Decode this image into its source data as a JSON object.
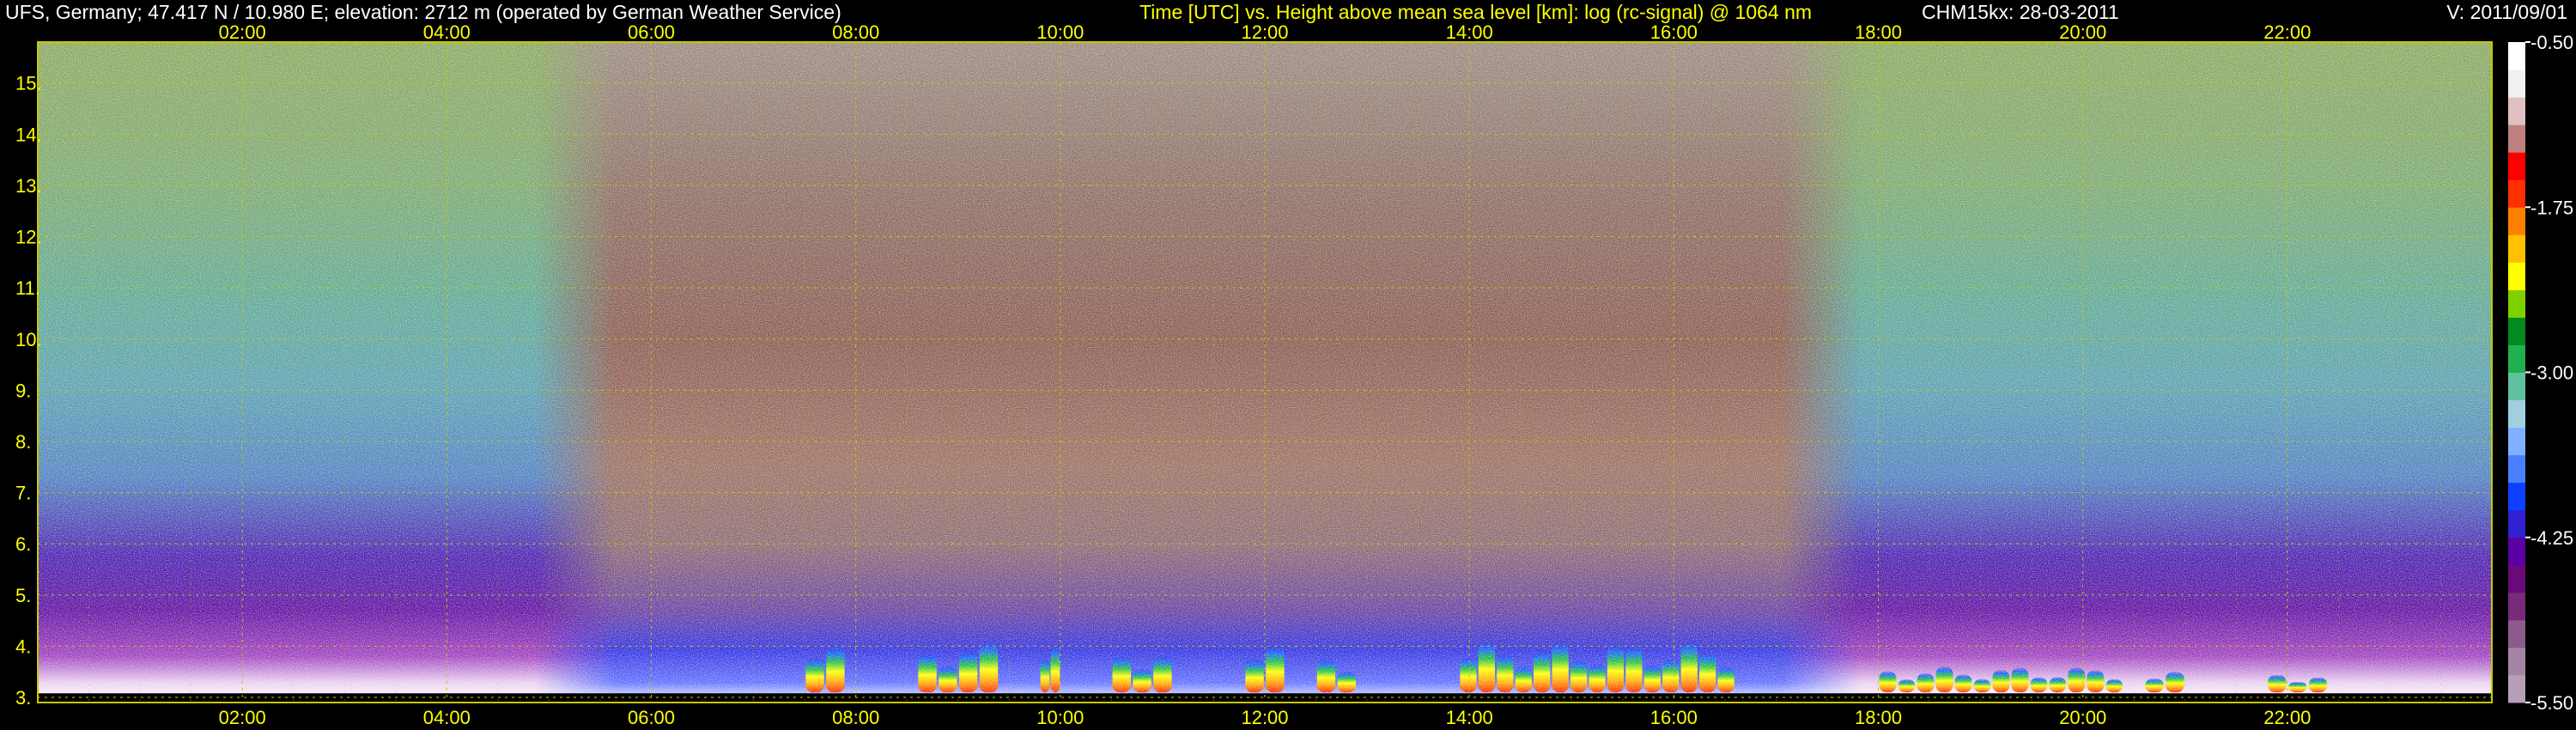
{
  "header": {
    "station": "UFS, Germany; 47.417 N / 10.980 E; elevation: 2712 m  (operated by German Weather Service)",
    "description": "Time [UTC] vs. Height above mean sea level [km]: log (rc-signal) @ 1064 nm",
    "instrument": "CHM15kx: 28-03-2011",
    "version": "V: 2011/09/01"
  },
  "colors": {
    "text_primary": "#ffff00",
    "text_secondary": "#ffffff",
    "background": "#000000",
    "grid": "#c8c800"
  },
  "chart_data": {
    "type": "heatmap",
    "title": "Time [UTC] vs. Height above mean sea level [km]: log (rc-signal) @ 1064 nm",
    "xlabel": "Time [UTC]",
    "ylabel": "Height above mean sea level [km]",
    "x_unit": "hours UTC",
    "xlim": [
      0.0,
      24.0
    ],
    "ylim": [
      2.9,
      15.8
    ],
    "x_ticks": [
      "02:00",
      "04:00",
      "06:00",
      "08:00",
      "10:00",
      "12:00",
      "14:00",
      "16:00",
      "18:00",
      "20:00",
      "22:00"
    ],
    "x_tick_values": [
      2,
      4,
      6,
      8,
      10,
      12,
      14,
      16,
      18,
      20,
      22
    ],
    "y_ticks": [
      "3.",
      "4.",
      "5.",
      "6.",
      "7.",
      "8.",
      "9.",
      "10.",
      "11.",
      "12.",
      "13.",
      "14.",
      "15."
    ],
    "y_tick_values": [
      3,
      4,
      5,
      6,
      7,
      8,
      9,
      10,
      11,
      12,
      13,
      14,
      15
    ],
    "grid": true,
    "colorbar": {
      "label": "log (rc-signal)",
      "range": [
        -5.5,
        -0.5
      ],
      "ticks": [
        "-0.50",
        "-1.75",
        "-3.00",
        "-4.25",
        "-5.50"
      ],
      "tick_values": [
        -0.5,
        -1.75,
        -3.0,
        -4.25,
        -5.5
      ],
      "palette": [
        "#b89fb8",
        "#a585a5",
        "#8c5a8c",
        "#7a2a7a",
        "#6a0a7a",
        "#5a00a5",
        "#3020d0",
        "#1040ff",
        "#4a80ff",
        "#80b0ff",
        "#a0d0e0",
        "#60c0a0",
        "#20b050",
        "#008a20",
        "#80d000",
        "#ffff00",
        "#ffc000",
        "#ff8000",
        "#ff3000",
        "#ff0000",
        "#c08080",
        "#e0c0c0",
        "#f0f0f0",
        "#ffffff"
      ]
    },
    "features": {
      "daylight_background_hours": [
        5.2,
        17.5
      ],
      "boundary_layer_clouds": [
        {
          "start": 7.5,
          "end": 7.9,
          "top_km": 4.0
        },
        {
          "start": 8.6,
          "end": 9.4,
          "top_km": 4.1
        },
        {
          "start": 9.8,
          "end": 10.0,
          "top_km": 4.0
        },
        {
          "start": 10.5,
          "end": 11.1,
          "top_km": 4.0
        },
        {
          "start": 11.8,
          "end": 12.2,
          "top_km": 4.0
        },
        {
          "start": 12.5,
          "end": 12.9,
          "top_km": 3.9
        },
        {
          "start": 13.9,
          "end": 16.6,
          "top_km": 4.1
        },
        {
          "start": 18.0,
          "end": 20.4,
          "top_km": 3.6
        },
        {
          "start": 20.6,
          "end": 21.0,
          "top_km": 3.5
        },
        {
          "start": 21.8,
          "end": 22.4,
          "top_km": 3.5
        }
      ]
    }
  }
}
